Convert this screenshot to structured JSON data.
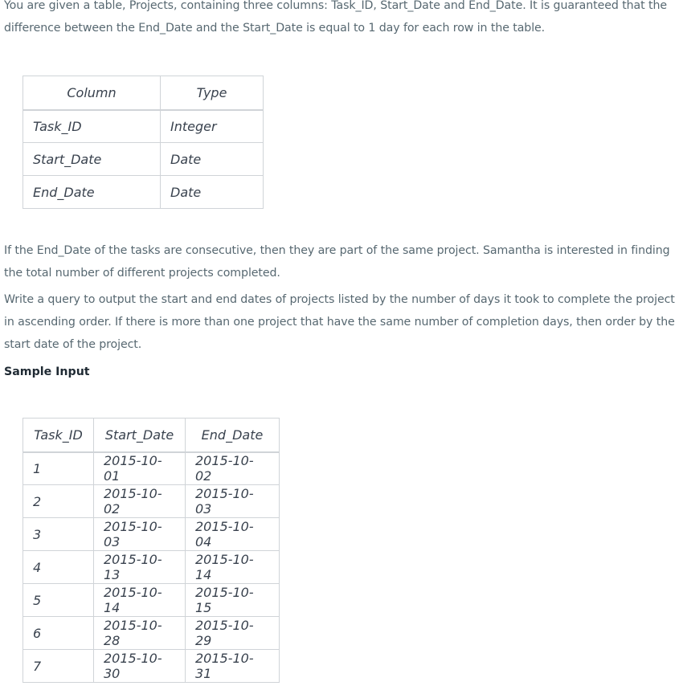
{
  "intro": "You are given a table, Projects, containing three columns: Task_ID, Start_Date and End_Date. It is guaranteed that the difference between the End_Date and the Start_Date is equal to 1 day for each row in the table.",
  "schema_table": {
    "headers": [
      "Column",
      "Type"
    ],
    "rows": [
      [
        "Task_ID",
        "Integer"
      ],
      [
        "Start_Date",
        "Date"
      ],
      [
        "End_Date",
        "Date"
      ]
    ]
  },
  "paragraph_2": "If the End_Date of the tasks are consecutive, then they are part of the same project. Samantha is interested in finding the total number of different projects completed.",
  "paragraph_3": "Write a query to output the start and end dates of projects listed by the number of days it took to complete the project in ascending order. If there is more than one project that have the same number of completion days, then order by the start date of the project.",
  "sample_heading": "Sample Input",
  "sample_table": {
    "headers": [
      "Task_ID",
      "Start_Date",
      "End_Date"
    ],
    "rows": [
      [
        "1",
        "2015-10-01",
        "2015-10-02"
      ],
      [
        "2",
        "2015-10-02",
        "2015-10-03"
      ],
      [
        "3",
        "2015-10-03",
        "2015-10-04"
      ],
      [
        "4",
        "2015-10-13",
        "2015-10-14"
      ],
      [
        "5",
        "2015-10-14",
        "2015-10-15"
      ],
      [
        "6",
        "2015-10-28",
        "2015-10-29"
      ],
      [
        "7",
        "2015-10-30",
        "2015-10-31"
      ]
    ]
  },
  "colors": {
    "body_text": "#576871",
    "table_text": "#39424e",
    "heading_text": "#1f2a33",
    "border": "#d0d4d8"
  }
}
